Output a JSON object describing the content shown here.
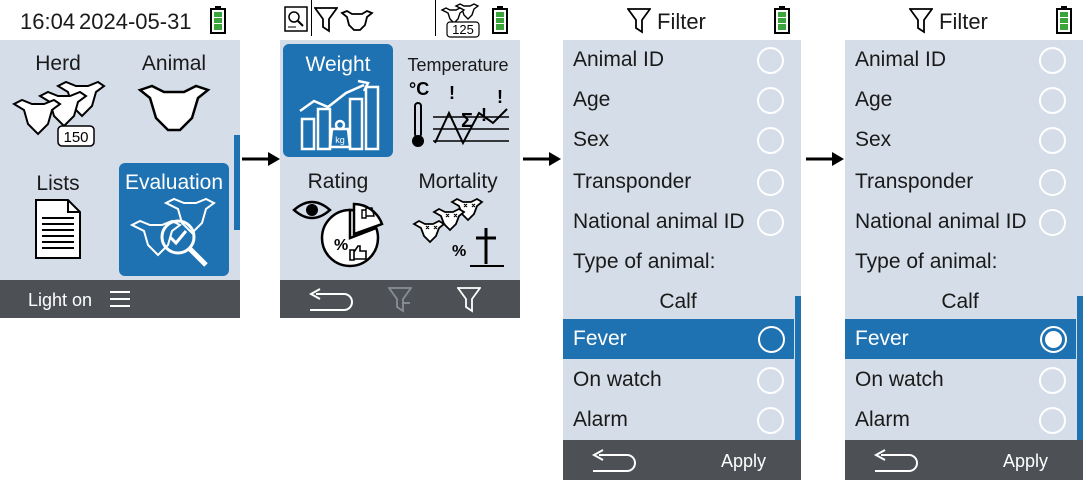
{
  "screen1": {
    "time": "16:04",
    "date": "2024-05-31",
    "tiles": [
      {
        "label": "Herd",
        "icon": "herd-icon",
        "badge": "150"
      },
      {
        "label": "Animal",
        "icon": "cow-head-icon"
      },
      {
        "label": "Lists",
        "icon": "document-icon"
      },
      {
        "label": "Evaluation",
        "icon": "evaluation-icon"
      }
    ],
    "bottom_label": "Light on",
    "menu_icon": "hamburger-menu-icon"
  },
  "screen2": {
    "status_badge": "125",
    "tiles": [
      {
        "label": "Weight",
        "icon": "weight-chart-icon"
      },
      {
        "label": "Temperature",
        "icon": "temperature-chart-icon"
      },
      {
        "label": "Rating",
        "icon": "rating-icon"
      },
      {
        "label": "Mortality",
        "icon": "mortality-icon"
      }
    ],
    "bottom_icons": [
      "back-arrow-icon",
      "filter-remove-icon",
      "filter-icon"
    ]
  },
  "screen3": {
    "title": "Filter",
    "items": [
      {
        "label": "Animal ID",
        "checked": false
      },
      {
        "label": "Age",
        "checked": false
      },
      {
        "label": "Sex",
        "checked": false
      },
      {
        "label": "Transponder",
        "checked": false
      },
      {
        "label": "National animal ID",
        "checked": false
      },
      {
        "label": "Type of animal:",
        "header": true
      },
      {
        "label": "Calf",
        "center": true
      },
      {
        "label": "Fever",
        "checked": false,
        "highlighted": true
      },
      {
        "label": "On watch",
        "checked": false
      },
      {
        "label": "Alarm",
        "checked": false
      }
    ],
    "apply_label": "Apply"
  },
  "screen4": {
    "title": "Filter",
    "items": [
      {
        "label": "Animal ID",
        "checked": false
      },
      {
        "label": "Age",
        "checked": false
      },
      {
        "label": "Sex",
        "checked": false
      },
      {
        "label": "Transponder",
        "checked": false
      },
      {
        "label": "National animal ID",
        "checked": false
      },
      {
        "label": "Type of animal:",
        "header": true
      },
      {
        "label": "Calf",
        "center": true
      },
      {
        "label": "Fever",
        "checked": true,
        "highlighted": true
      },
      {
        "label": "On watch",
        "checked": false
      },
      {
        "label": "Alarm",
        "checked": false
      }
    ],
    "apply_label": "Apply"
  },
  "colors": {
    "accent": "#1f72b1",
    "panel": "#d4dde8",
    "bottombar": "#4d5156",
    "battery": "#3aa53a"
  }
}
